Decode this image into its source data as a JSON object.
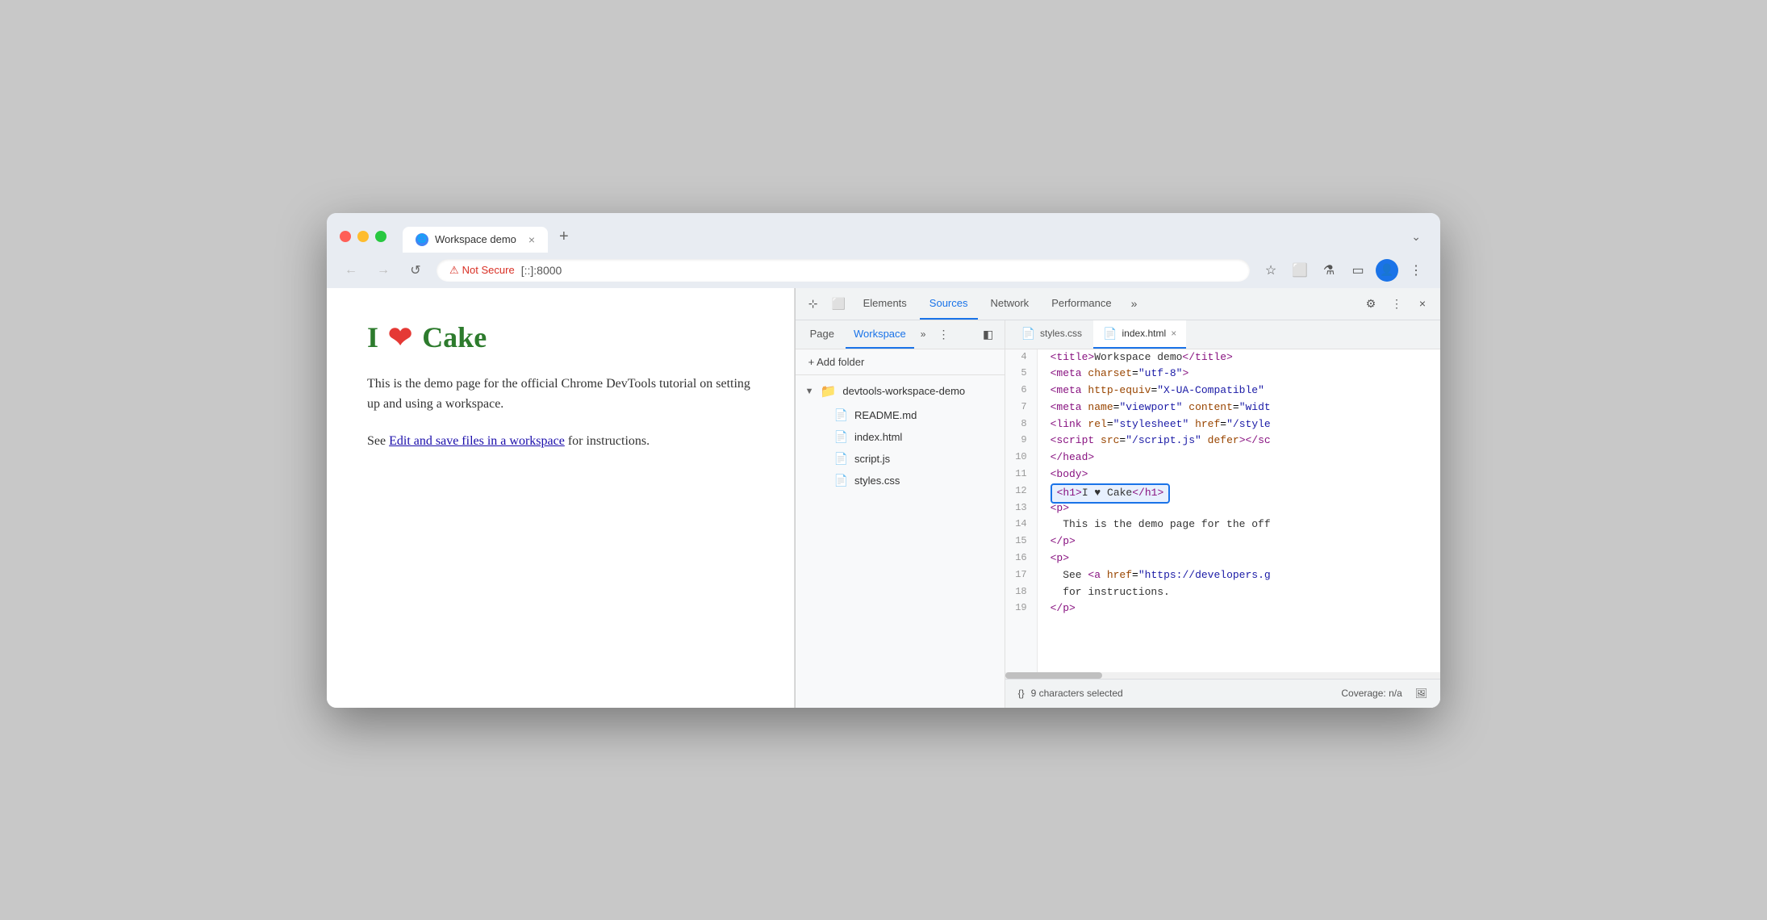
{
  "browser": {
    "tab_title": "Workspace demo",
    "tab_close": "×",
    "tab_new": "+",
    "tab_expand": "⌄",
    "nav_back": "←",
    "nav_forward": "→",
    "nav_refresh": "↺",
    "not_secure_label": "Not Secure",
    "url": "[::]:8000",
    "bookmark_icon": "☆",
    "extension_icon": "⬜",
    "lab_icon": "⚗",
    "sidebar_icon": "▭",
    "profile_icon": "👤",
    "more_icon": "⋮"
  },
  "page": {
    "heading_text": "I",
    "heading_cake": "Cake",
    "para1": "This is the demo page for the official Chrome DevTools tutorial on setting up and using a workspace.",
    "para2_prefix": "See ",
    "link_text": "Edit and save files in a workspace",
    "para2_suffix": " for instructions."
  },
  "devtools": {
    "toolbar": {
      "cursor_icon": "⊹",
      "device_icon": "⬜",
      "tabs": [
        "Elements",
        "Sources",
        "Network",
        "Performance"
      ],
      "active_tab": "Sources",
      "more": "»",
      "settings_icon": "⚙",
      "more_icon": "⋮",
      "close_icon": "×"
    },
    "sources": {
      "tabs": [
        "Page",
        "Workspace"
      ],
      "active_tab": "Workspace",
      "more": "»",
      "more_icon": "⋮",
      "sidebar_toggle": "◧",
      "add_folder": "+ Add folder",
      "folder_name": "devtools-workspace-demo",
      "files": [
        {
          "name": "README.md",
          "type": "md"
        },
        {
          "name": "index.html",
          "type": "html"
        },
        {
          "name": "script.js",
          "type": "js"
        },
        {
          "name": "styles.css",
          "type": "css"
        }
      ],
      "open_tabs": [
        "styles.css",
        "index.html"
      ],
      "active_file": "index.html"
    },
    "code": {
      "lines": [
        {
          "num": 4,
          "content": "    <title>Workspace demo</title>",
          "highlighted": false
        },
        {
          "num": 5,
          "content": "    <meta charset=\"utf-8\">",
          "highlighted": false
        },
        {
          "num": 6,
          "content": "    <meta http-equiv=\"X-UA-Compatible\"",
          "highlighted": false
        },
        {
          "num": 7,
          "content": "    <meta name=\"viewport\" content=\"widt",
          "highlighted": false
        },
        {
          "num": 8,
          "content": "    <link rel=\"stylesheet\" href=\"/style",
          "highlighted": false
        },
        {
          "num": 9,
          "content": "    <script src=\"/script.js\" defer></sc",
          "highlighted": false
        },
        {
          "num": 10,
          "content": "  </head>",
          "highlighted": false
        },
        {
          "num": 11,
          "content": "  <body>",
          "highlighted": false
        },
        {
          "num": 12,
          "content": "    <h1>I ♥ Cake</h1>",
          "highlighted": true
        },
        {
          "num": 13,
          "content": "    <p>",
          "highlighted": false
        },
        {
          "num": 14,
          "content": "      This is the demo page for the off",
          "highlighted": false
        },
        {
          "num": 15,
          "content": "    </p>",
          "highlighted": false
        },
        {
          "num": 16,
          "content": "    <p>",
          "highlighted": false
        },
        {
          "num": 17,
          "content": "      See <a href=\"https://developers.g",
          "highlighted": false
        },
        {
          "num": 18,
          "content": "      for instructions.",
          "highlighted": false
        },
        {
          "num": 19,
          "content": "    </p>",
          "highlighted": false
        }
      ]
    },
    "statusbar": {
      "format_icon": "{}",
      "selected_text": "9 characters selected",
      "coverage_label": "Coverage: n/a",
      "screenshot_icon": "🖼"
    }
  }
}
